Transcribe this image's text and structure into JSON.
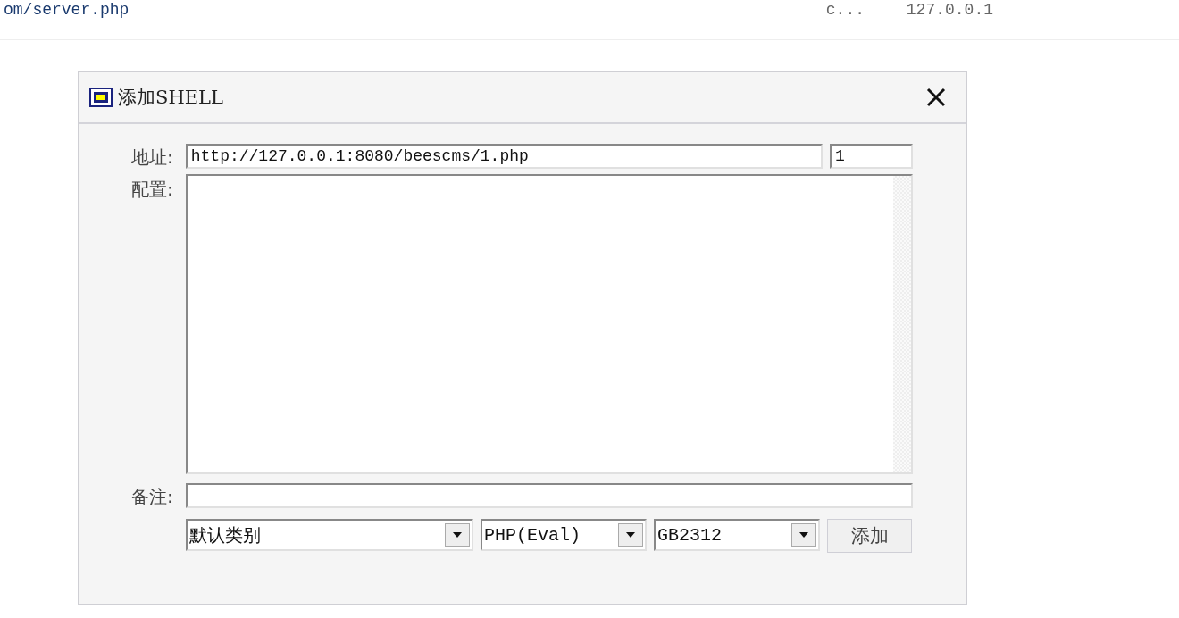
{
  "top_bar": {
    "url": "om/server.php",
    "column_2": "c...",
    "ip": "127.0.0.1"
  },
  "dialog": {
    "title": "添加SHELL",
    "address": {
      "label": "地址:",
      "value": "http://127.0.0.1:8080/beescms/1.php",
      "password": "1"
    },
    "config": {
      "label": "配置:"
    },
    "note": {
      "label": "备注:"
    },
    "selects": [
      {
        "value": "默认类别"
      },
      {
        "value": "PHP(Eval)"
      },
      {
        "value": "GB2312"
      }
    ],
    "button": "添加"
  }
}
